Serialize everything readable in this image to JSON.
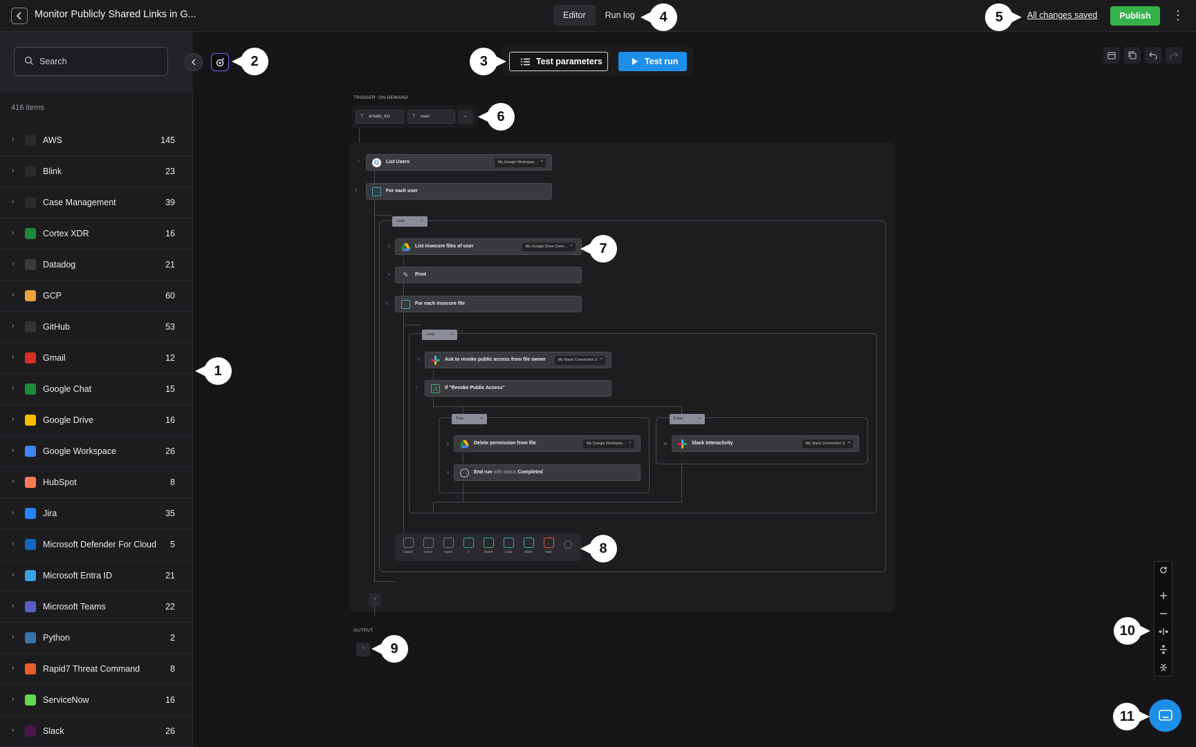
{
  "header": {
    "title": "Monitor Publicly Shared Links in G...",
    "tabs": [
      "Editor",
      "Run log"
    ],
    "saved_label": "All changes saved",
    "publish_label": "Publish"
  },
  "sidebar": {
    "search_placeholder": "Search",
    "count_label": "416 items",
    "items": [
      {
        "label": "AWS",
        "count": "145",
        "icon": "aws-icon",
        "color": "#2b2b2b"
      },
      {
        "label": "Blink",
        "count": "23",
        "icon": "blink-icon",
        "color": "#2b2b2b"
      },
      {
        "label": "Case Management",
        "count": "39",
        "icon": "case-icon",
        "color": "#2b2b2b"
      },
      {
        "label": "Cortex XDR",
        "count": "16",
        "icon": "cortex-icon",
        "color": "#1f8a3a"
      },
      {
        "label": "Datadog",
        "count": "21",
        "icon": "datadog-icon",
        "color": "#3a3a3a"
      },
      {
        "label": "GCP",
        "count": "60",
        "icon": "gcp-icon",
        "color": "#e8a33a"
      },
      {
        "label": "GitHub",
        "count": "53",
        "icon": "github-icon",
        "color": "#333333"
      },
      {
        "label": "Gmail",
        "count": "12",
        "icon": "gmail-icon",
        "color": "#d93025"
      },
      {
        "label": "Google Chat",
        "count": "15",
        "icon": "google-chat-icon",
        "color": "#1e8e3e"
      },
      {
        "label": "Google Drive",
        "count": "16",
        "icon": "google-drive-icon",
        "color": "#fbbc04"
      },
      {
        "label": "Google Workspace",
        "count": "26",
        "icon": "google-icon",
        "color": "#4285f4"
      },
      {
        "label": "HubSpot",
        "count": "8",
        "icon": "hubspot-icon",
        "color": "#ff7a59"
      },
      {
        "label": "Jira",
        "count": "35",
        "icon": "jira-icon",
        "color": "#2684ff"
      },
      {
        "label": "Microsoft Defender For Cloud",
        "count": "5",
        "icon": "defender-icon",
        "color": "#1565c0"
      },
      {
        "label": "Microsoft Entra ID",
        "count": "21",
        "icon": "entra-icon",
        "color": "#3aa0e8"
      },
      {
        "label": "Microsoft Teams",
        "count": "22",
        "icon": "teams-icon",
        "color": "#5b5fc7"
      },
      {
        "label": "Python",
        "count": "2",
        "icon": "python-icon",
        "color": "#3776ab"
      },
      {
        "label": "Rapid7 Threat Command",
        "count": "8",
        "icon": "rapid7-icon",
        "color": "#e85d2a"
      },
      {
        "label": "ServiceNow",
        "count": "16",
        "icon": "servicenow-icon",
        "color": "#62d84e"
      },
      {
        "label": "Slack",
        "count": "26",
        "icon": "slack-icon",
        "color": "#4a154b"
      }
    ]
  },
  "toolbar": {
    "test_params_label": "Test parameters",
    "test_run_label": "Test run"
  },
  "workflow": {
    "trigger_label": "TRIGGER: ON-DEMAND",
    "params": [
      "emails_list",
      "user"
    ],
    "output_label": "OUTPUT",
    "nodes": {
      "list_users": {
        "label": "List Users",
        "conn": "My Google Workspac..."
      },
      "for_each_user": {
        "label": "For each user"
      },
      "loop1": "Loop",
      "list_insecure": {
        "label": "List insecure files of user",
        "conn": "My Google Drive Conn..."
      },
      "print": {
        "label": "Print"
      },
      "for_each_file": {
        "label": "For each insecure file"
      },
      "loop2": "Loop",
      "ask_revoke": {
        "label": "Ask to revoke public access from file owner",
        "conn": "My Slack Connection 3"
      },
      "if_revoke": {
        "label": "If \"Revoke Public Access\""
      },
      "true_pill": "True",
      "false_pill": "False",
      "delete_perm": {
        "label": "Delete permission from file",
        "conn": "My Google Workspac..."
      },
      "end_run": {
        "label": "End run",
        "with": "with status",
        "status": "Completed"
      },
      "slack_inter": {
        "label": "Slack Interactivity",
        "conn": "My Slack Connection 3"
      }
    },
    "step_numbers": [
      "1",
      "2",
      "3",
      "4",
      "5",
      "6",
      "7",
      "8",
      "9",
      "10"
    ],
    "palette": [
      "Copilot",
      "Action",
      "Agent",
      "If",
      "Switch",
      "Loop",
      "While",
      "Wait"
    ]
  },
  "callouts": [
    "1",
    "2",
    "3",
    "4",
    "5",
    "6",
    "7",
    "8",
    "9",
    "10",
    "11"
  ]
}
